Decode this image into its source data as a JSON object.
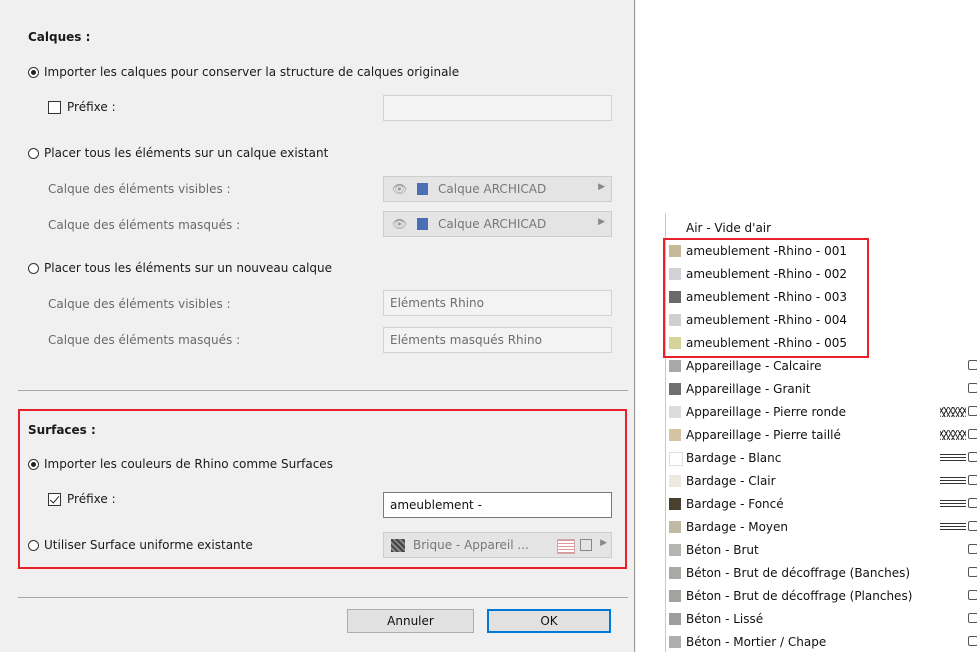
{
  "dialog": {
    "layers_heading": "Calques :",
    "opt_import_layers": "Importer les calques pour conserver la structure de calques originale",
    "prefix_label": "Préfixe :",
    "opt_existing_layer": "Placer tous les éléments sur un calque existant",
    "visible_elements_label": "Calque des éléments visibles :",
    "hidden_elements_label": "Calque des éléments masqués :",
    "existing_visible_value": "Calque ARCHICAD",
    "existing_hidden_value": "Calque ARCHICAD",
    "opt_new_layer": "Placer tous les éléments sur un nouveau calque",
    "new_visible_value": "Eléments Rhino",
    "new_hidden_value": "Eléments masqués Rhino",
    "surfaces_heading": "Surfaces :",
    "opt_import_colors": "Importer les couleurs de Rhino comme Surfaces",
    "surface_prefix_label": "Préfixe :",
    "surface_prefix_value": "ameublement -",
    "opt_uniform_surface": "Utiliser Surface uniforme existante",
    "uniform_surface_value": "Brique - Appareil ...",
    "cancel_label": "Annuler",
    "ok_label": "OK"
  },
  "surface_list": {
    "items": [
      {
        "label": "Air - Vide d'air",
        "color": ""
      },
      {
        "label": "ameublement -Rhino - 001",
        "color": "#c8b89a"
      },
      {
        "label": "ameublement -Rhino - 002",
        "color": "#d2d2d6"
      },
      {
        "label": "ameublement -Rhino - 003",
        "color": "#6a6a6a"
      },
      {
        "label": "ameublement -Rhino - 004",
        "color": "#cfcfcf"
      },
      {
        "label": "ameublement -Rhino - 005",
        "color": "#d6d49a"
      },
      {
        "label": "Appareillage - Calcaire",
        "color": "#a9a9a9"
      },
      {
        "label": "Appareillage - Granit",
        "color": "#6f6f6f"
      },
      {
        "label": "Appareillage - Pierre ronde",
        "color": "#dcdcdc"
      },
      {
        "label": "Appareillage - Pierre taillé",
        "color": "#d4c4a4"
      },
      {
        "label": "Bardage - Blanc",
        "color": "#ffffff"
      },
      {
        "label": "Bardage - Clair",
        "color": "#ede9de"
      },
      {
        "label": "Bardage - Foncé",
        "color": "#4a4032"
      },
      {
        "label": "Bardage - Moyen",
        "color": "#c0b9a6"
      },
      {
        "label": "Béton - Brut",
        "color": "#b4b4b0"
      },
      {
        "label": "Béton - Brut de décoffrage (Banches)",
        "color": "#a8a8a4"
      },
      {
        "label": "Béton - Brut de décoffrage (Planches)",
        "color": "#a2a29e"
      },
      {
        "label": "Béton - Lissé",
        "color": "#9e9e9e"
      },
      {
        "label": "Béton - Mortier / Chape",
        "color": "#aeaeae"
      }
    ]
  }
}
